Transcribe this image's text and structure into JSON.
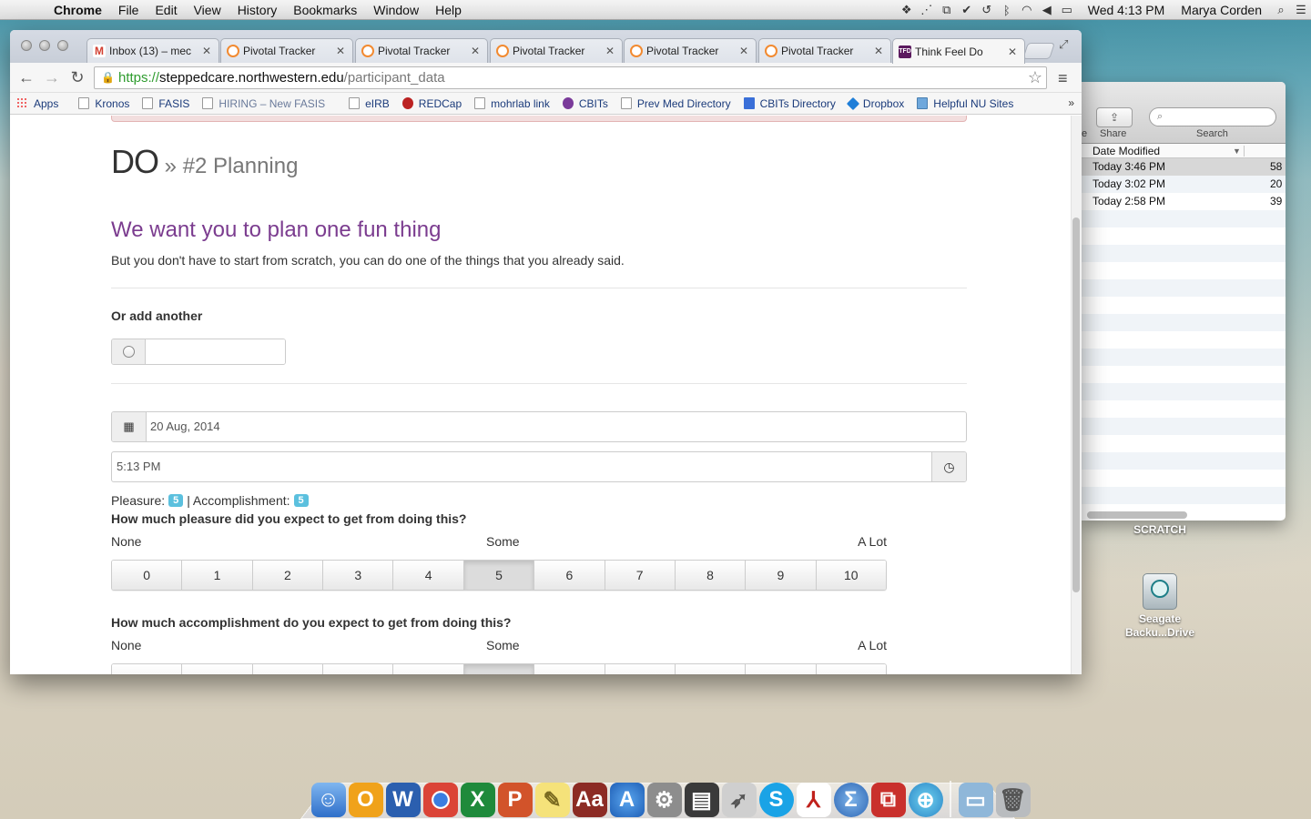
{
  "menubar": {
    "app": "Chrome",
    "items": [
      "File",
      "Edit",
      "View",
      "History",
      "Bookmarks",
      "Window",
      "Help"
    ],
    "clock": "Wed 4:13 PM",
    "user": "Marya Corden"
  },
  "finder": {
    "share_label": "Share",
    "search_label": "Search",
    "column_header": "Date Modified",
    "rows": [
      {
        "date": "Today 3:46 PM",
        "size": "58"
      },
      {
        "date": "Today 3:02 PM",
        "size": "20"
      },
      {
        "date": "Today 2:58 PM",
        "size": "39"
      }
    ]
  },
  "desktop_icons": {
    "scratch": "SCRATCH",
    "seagate_line1": "Seagate",
    "seagate_line2": "Backu...Drive"
  },
  "tabs": [
    {
      "title": "Inbox (13) – mec",
      "icon": "gmail-icon"
    },
    {
      "title": "Pivotal Tracker",
      "icon": "pivotal-icon"
    },
    {
      "title": "Pivotal Tracker",
      "icon": "pivotal-icon"
    },
    {
      "title": "Pivotal Tracker",
      "icon": "pivotal-icon"
    },
    {
      "title": "Pivotal Tracker",
      "icon": "pivotal-icon"
    },
    {
      "title": "Pivotal Tracker",
      "icon": "pivotal-icon"
    },
    {
      "title": "Think Feel Do",
      "icon": "tfd-icon",
      "active": true
    }
  ],
  "omnibox": {
    "scheme": "https://",
    "host": "steppedcare.northwestern.edu",
    "path": "/participant_data"
  },
  "bookmarks": [
    {
      "label": "Apps"
    },
    {
      "label": "Kronos"
    },
    {
      "label": "FASIS"
    },
    {
      "label": "HIRING – New FASIS"
    },
    {
      "label": "eIRB"
    },
    {
      "label": "REDCap"
    },
    {
      "label": "mohrlab link"
    },
    {
      "label": "CBITs"
    },
    {
      "label": "Prev Med Directory"
    },
    {
      "label": "CBITs Directory"
    },
    {
      "label": "Dropbox"
    },
    {
      "label": "Helpful NU Sites"
    }
  ],
  "bookmarks_more": "»",
  "page": {
    "title_main": "DO",
    "title_sep": " » ",
    "title_sub": "#2 Planning",
    "headline": "We want you to plan one fun thing",
    "subtext": "But you don't have to start from scratch, you can do one of the things that you already said.",
    "add_another_label": "Or add another",
    "add_another_value": "",
    "date_value": "20 Aug, 2014",
    "time_value": "5:13 PM",
    "pleasure_label": "Pleasure:",
    "pleasure_value": "5",
    "score_sep": " | ",
    "accomplishment_label": "Accomplishment:",
    "accomplishment_value": "5",
    "q1": "How much pleasure did you expect to get from doing this?",
    "q2": "How much accomplishment do you expect to get from doing this?",
    "scale_none": "None",
    "scale_some": "Some",
    "scale_alot": "A Lot",
    "scale_options": [
      "0",
      "1",
      "2",
      "3",
      "4",
      "5",
      "6",
      "7",
      "8",
      "9",
      "10"
    ],
    "q1_selected": 5,
    "q2_selected": 5
  },
  "colors": {
    "headline": "#7b3c8f",
    "badge": "#5bc0de",
    "alert": "#f2dede"
  }
}
